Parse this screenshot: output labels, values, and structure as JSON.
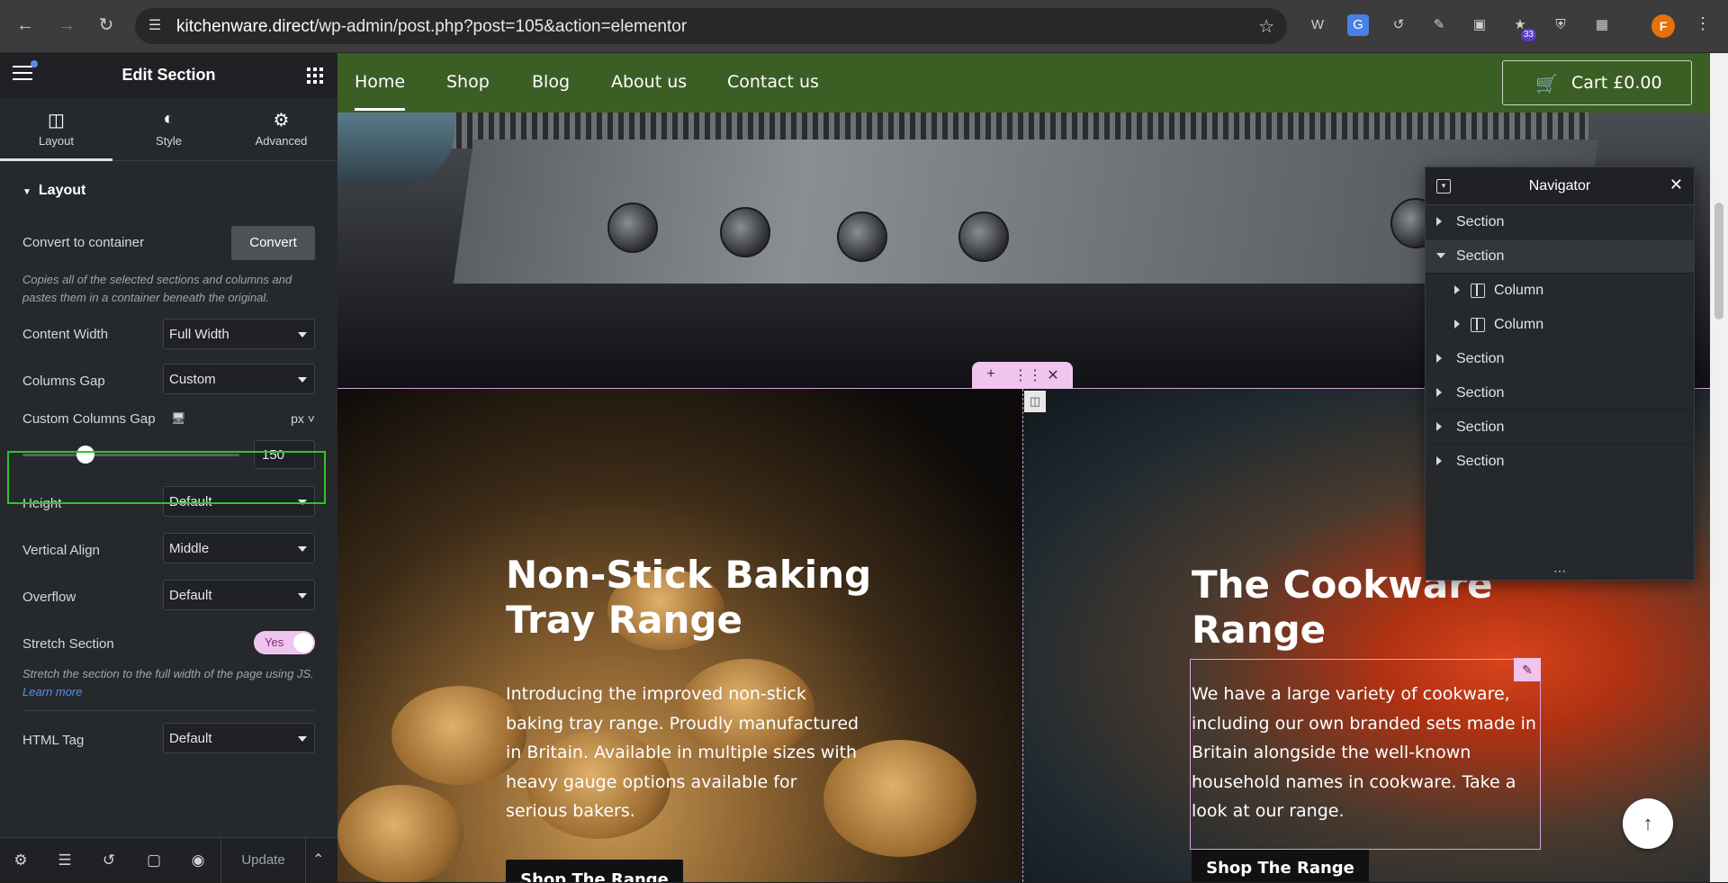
{
  "browser": {
    "url_host": "kitchenware.direct",
    "url_path": "/wp-admin/post.php?post=105&action=elementor",
    "extensions_badge": "33",
    "profile_initial": "F"
  },
  "panel": {
    "title": "Edit Section",
    "tabs": [
      {
        "label": "Layout",
        "icon": "layout-icon"
      },
      {
        "label": "Style",
        "icon": "contrast-icon"
      },
      {
        "label": "Advanced",
        "icon": "gear-icon"
      }
    ],
    "section_title": "Layout",
    "convert_label": "Convert to container",
    "convert_button": "Convert",
    "convert_help": "Copies all of the selected sections and columns and pastes them in a container beneath the original.",
    "content_width_label": "Content Width",
    "content_width_value": "Full Width",
    "columns_gap_label": "Columns Gap",
    "columns_gap_value": "Custom",
    "custom_gap_label": "Custom Columns Gap",
    "custom_gap_unit": "px",
    "custom_gap_value": "150",
    "custom_gap_slider_fraction": 0.29,
    "height_label": "Height",
    "height_value": "Default",
    "vertical_align_label": "Vertical Align",
    "vertical_align_value": "Middle",
    "overflow_label": "Overflow",
    "overflow_value": "Default",
    "stretch_label": "Stretch Section",
    "stretch_value": "Yes",
    "stretch_help": "Stretch the section to the full width of the page using JS.",
    "stretch_help_link": "Learn more",
    "html_tag_label": "HTML Tag",
    "html_tag_value": "Default",
    "footer_update": "Update"
  },
  "site": {
    "nav": [
      "Home",
      "Shop",
      "Blog",
      "About us",
      "Contact us"
    ],
    "cart": "Cart £0.00",
    "left_heading": "Non-Stick Baking Tray Range",
    "left_text": "Introducing the improved non-stick baking tray range. Proudly manufactured in Britain. Available in multiple sizes with heavy gauge options available for serious bakers.",
    "left_button": "Shop The Range",
    "right_heading": "The Cookware Range",
    "right_text": "We have a large variety of cookware, including our own branded sets made in Britain alongside the well-known household names in cookware. Take a look at our range.",
    "right_button": "Shop The Range"
  },
  "navigator": {
    "title": "Navigator",
    "rows": [
      {
        "label": "Section",
        "type": "section",
        "expanded": false,
        "selected": false
      },
      {
        "label": "Section",
        "type": "section",
        "expanded": true,
        "selected": true
      },
      {
        "label": "Column",
        "type": "column",
        "expanded": false,
        "selected": false
      },
      {
        "label": "Column",
        "type": "column",
        "expanded": false,
        "selected": false
      },
      {
        "label": "Section",
        "type": "section",
        "expanded": false,
        "selected": false
      },
      {
        "label": "Section",
        "type": "section",
        "expanded": false,
        "selected": false
      },
      {
        "label": "Section",
        "type": "section",
        "expanded": false,
        "selected": false
      },
      {
        "label": "Section",
        "type": "section",
        "expanded": false,
        "selected": false
      }
    ]
  },
  "colors": {
    "site_nav": "#3b5e25",
    "panel": "#26292c",
    "accent_pink": "#f1c4ee",
    "highlight": "#2ec52e"
  }
}
